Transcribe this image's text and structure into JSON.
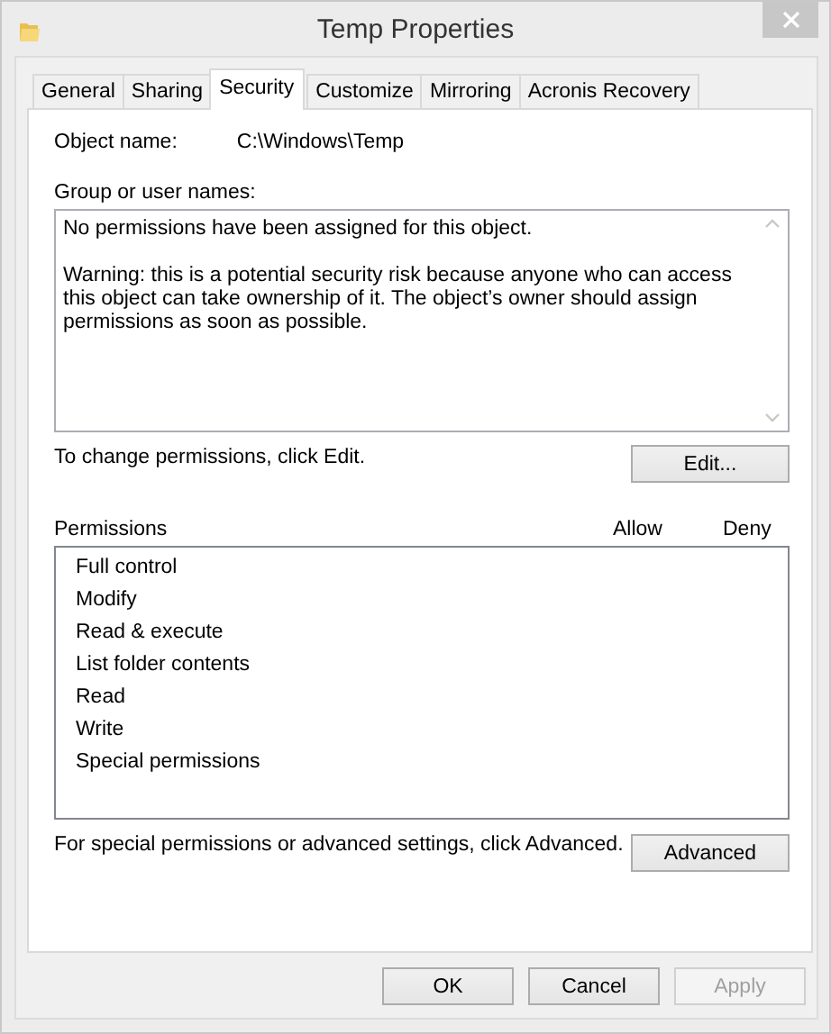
{
  "window": {
    "title": "Temp Properties"
  },
  "tabs": [
    {
      "label": "General",
      "selected": false
    },
    {
      "label": "Sharing",
      "selected": false
    },
    {
      "label": "Security",
      "selected": true
    },
    {
      "label": "Customize",
      "selected": false
    },
    {
      "label": "Mirroring",
      "selected": false
    },
    {
      "label": "Acronis Recovery",
      "selected": false
    }
  ],
  "object_name": {
    "label": "Object name:",
    "value": "C:\\Windows\\Temp"
  },
  "group_names": {
    "label": "Group or user names:",
    "paragraphs": [
      "No permissions have been assigned for this object.",
      "Warning: this is a potential security risk because anyone who can access this object can take ownership of it. The object’s owner should assign permissions as soon as possible."
    ]
  },
  "edit_hint": "To change permissions, click Edit.",
  "edit_button": {
    "label": "Edit...",
    "disabled": false
  },
  "permissions": {
    "label": "Permissions",
    "columns": [
      "Allow",
      "Deny"
    ],
    "rows": [
      "Full control",
      "Modify",
      "Read & execute",
      "List folder contents",
      "Read",
      "Write",
      "Special permissions"
    ]
  },
  "advanced_hint": "For special permissions or advanced settings, click Advanced.",
  "advanced_button": {
    "label": "Advanced",
    "disabled": false
  },
  "buttons": [
    {
      "label": "OK",
      "disabled": false
    },
    {
      "label": "Cancel",
      "disabled": false
    },
    {
      "label": "Apply",
      "disabled": true
    }
  ]
}
